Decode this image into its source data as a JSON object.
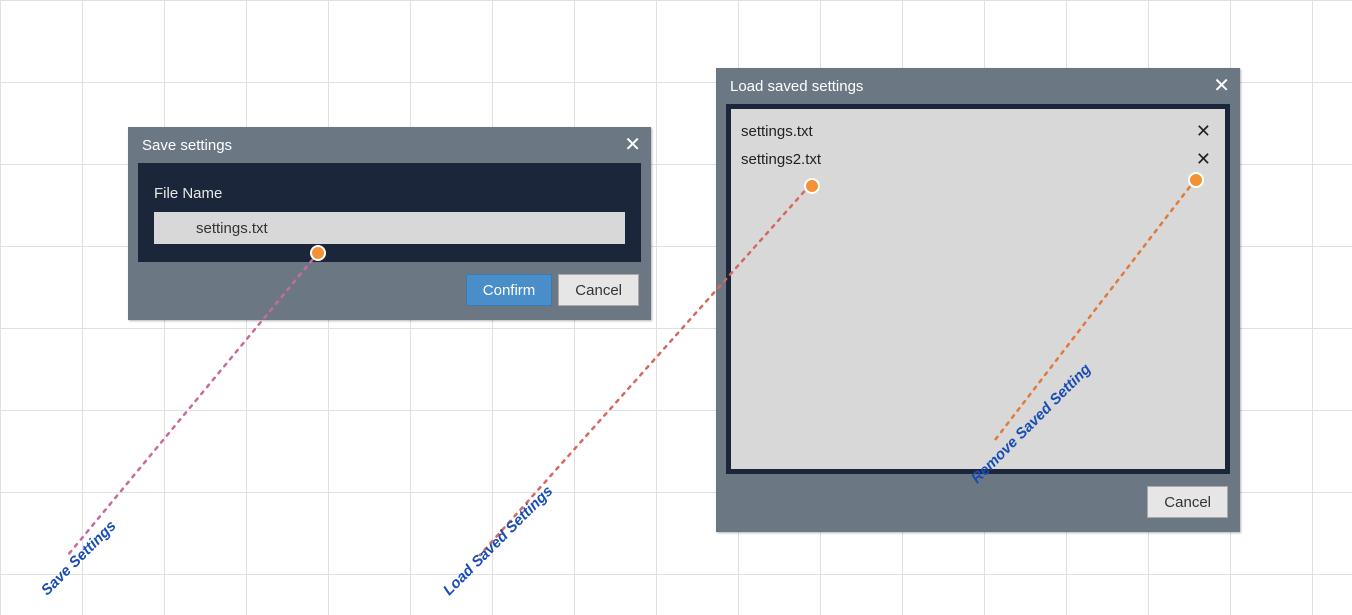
{
  "dialogs": {
    "save": {
      "title": "Save settings",
      "field_label": "File Name",
      "filename_value": "settings.txt",
      "confirm_label": "Confirm",
      "cancel_label": "Cancel"
    },
    "load": {
      "title": "Load saved settings",
      "items": [
        {
          "name": "settings.txt"
        },
        {
          "name": "settings2.txt"
        }
      ],
      "cancel_label": "Cancel"
    }
  },
  "annotations": {
    "save_settings": "Save Settings",
    "load_saved_settings": "Load Saved Settings",
    "remove_saved_setting": "Remove Saved Setting"
  }
}
